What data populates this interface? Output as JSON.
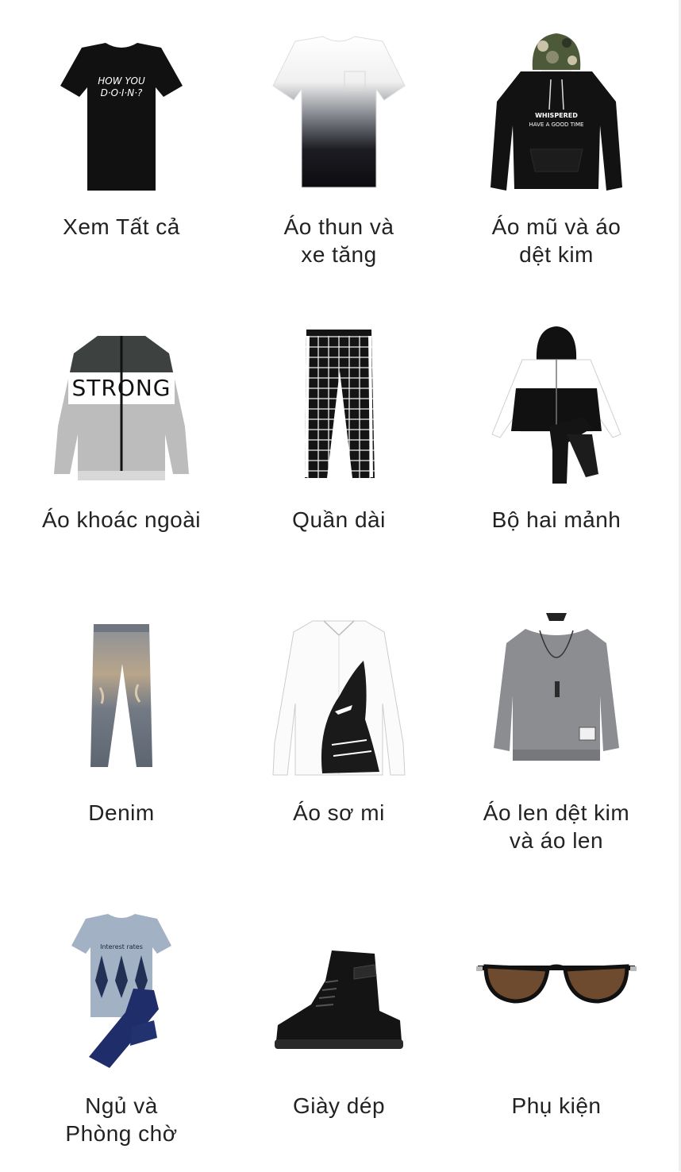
{
  "categories": [
    {
      "label": "Xem Tất cả",
      "icon": "black-tshirt-icon"
    },
    {
      "label": "Áo thun và\nxe tăng",
      "icon": "gradient-tshirt-icon"
    },
    {
      "label": "Áo mũ và áo\ndệt kim",
      "icon": "camo-hoodie-icon"
    },
    {
      "label": "Áo khoác ngoài",
      "icon": "strong-jacket-icon"
    },
    {
      "label": "Quần dài",
      "icon": "plaid-pants-icon"
    },
    {
      "label": "Bộ hai mảnh",
      "icon": "tracksuit-icon"
    },
    {
      "label": "Denim",
      "icon": "jeans-icon"
    },
    {
      "label": "Áo sơ mi",
      "icon": "shark-shirt-icon"
    },
    {
      "label": "Áo len dệt kim\nvà áo len",
      "icon": "grey-sweater-icon"
    },
    {
      "label": "Ngủ và\nPhòng chờ",
      "icon": "loungewear-set-icon"
    },
    {
      "label": "Giày dép",
      "icon": "black-boot-icon"
    },
    {
      "label": "Phụ kiện",
      "icon": "sunglasses-icon"
    }
  ],
  "graphics": {
    "tshirt_print": [
      "HOW YOU",
      "D·O·I·N·?"
    ],
    "hoodie_print": [
      "WHISPERED",
      "HAVE A GOOD TIME"
    ],
    "jacket_print": "STRONG",
    "lounge_print": "Interest rates"
  }
}
